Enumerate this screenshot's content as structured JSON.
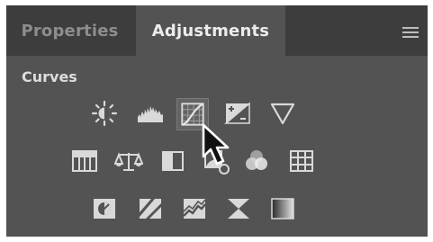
{
  "tabs": [
    {
      "label": "Properties",
      "active": false
    },
    {
      "label": "Adjustments",
      "active": true
    }
  ],
  "section": {
    "title": "Curves"
  },
  "icons": {
    "row1": [
      "brightness-contrast-icon",
      "levels-icon",
      "curves-icon",
      "exposure-icon",
      "vibrance-icon"
    ],
    "row2": [
      "hue-saturation-icon",
      "color-balance-icon",
      "black-white-icon",
      "photo-filter-icon",
      "channel-mixer-icon",
      "color-lookup-icon"
    ],
    "row3": [
      "invert-icon",
      "posterize-icon",
      "threshold-icon",
      "selective-color-icon",
      "gradient-map-icon"
    ]
  },
  "hovered_icon": "curves-icon",
  "colors": {
    "panel": "#535353",
    "tab_bar": "#3d3d3d",
    "icon": "#d9d9d9"
  }
}
